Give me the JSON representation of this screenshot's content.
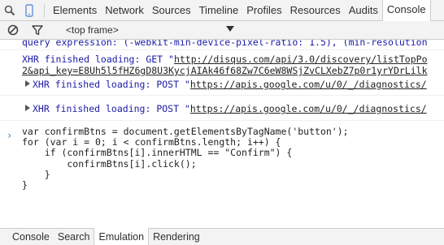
{
  "tabs": [
    "Elements",
    "Network",
    "Sources",
    "Timeline",
    "Profiles",
    "Resources",
    "Audits",
    "Console"
  ],
  "active_tab": "Console",
  "toolbar": {
    "frame_label": "<top frame>"
  },
  "messages": {
    "m0": "query expression: (-webkit-min-device-pixel-ratio: 1.5), (min-resolution",
    "m1_prefix": "XHR finished loading: GET \"",
    "m1_url": "http://disqus.com/api/3.0/discovery/listTopPo",
    "m1_cont": "2&api_key=E8Uh5l5fHZ6gD8U3KycjAIAk46f68Zw7C6eW8WSjZvCLXebZ7p0r1yrYDrLilk",
    "m2_prefix": "XHR finished loading: POST \"",
    "m2_url": "https://apis.google.com/u/0/_/diagnostics/",
    "m3_prefix": "XHR finished loading: POST \"",
    "m3_url": "https://apis.google.com/u/0/_/diagnostics/"
  },
  "prompt": {
    "arrow": "›",
    "code": "var confirmBtns = document.getElementsByTagName('button');\nfor (var i = 0; i < confirmBtns.length; i++) {\n    if (confirmBtns[i].innerHTML == \"Confirm\") {\n        confirmBtns[i].click();\n    }\n}"
  },
  "drawer_tabs": [
    "Console",
    "Search",
    "Emulation",
    "Rendering"
  ],
  "active_drawer_tab": "Emulation",
  "colors": {
    "xhr_text": "#1a1aa6",
    "prompt_arrow": "#2b7cd3",
    "toolbar_bg": "#f3f3f3"
  },
  "icons": [
    "search-icon",
    "device-icon",
    "clear-icon",
    "filter-icon",
    "dropdown-arrow-icon",
    "expand-triangle-icon"
  ]
}
